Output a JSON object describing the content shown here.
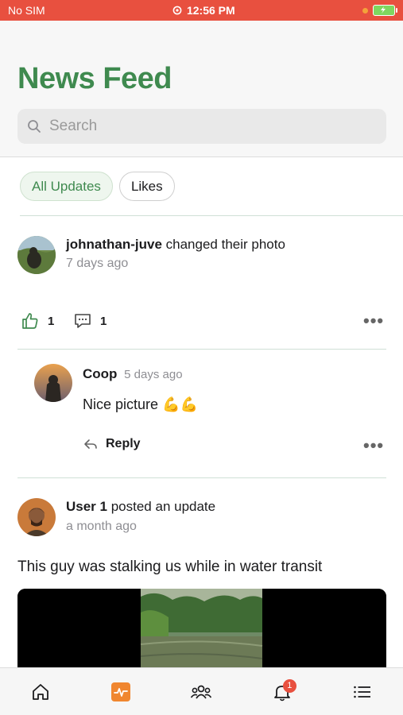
{
  "status_bar": {
    "carrier": "No SIM",
    "time": "12:56 PM"
  },
  "header": {
    "title": "News Feed",
    "search_placeholder": "Search"
  },
  "filters": [
    {
      "label": "All Updates",
      "active": true
    },
    {
      "label": "Likes",
      "active": false
    }
  ],
  "posts": [
    {
      "author": "johnathan-juve",
      "action": "changed their photo",
      "time": "7 days ago",
      "likes": "1",
      "comments_count": "1",
      "comments": [
        {
          "author": "Coop",
          "time": "5 days ago",
          "text": "Nice picture 💪💪",
          "reply_label": "Reply"
        }
      ]
    },
    {
      "author": "User 1",
      "action": "posted an update",
      "time": "a month ago",
      "text": "This guy was stalking us while in water transit"
    }
  ],
  "tabbar": {
    "items": [
      {
        "icon": "home-icon"
      },
      {
        "icon": "activity-icon",
        "active": true
      },
      {
        "icon": "groups-icon"
      },
      {
        "icon": "bell-icon",
        "badge": "1"
      },
      {
        "icon": "menu-icon"
      }
    ]
  },
  "colors": {
    "accent": "#3f8a4f",
    "status_bar": "#e8503f",
    "badge": "#e8503f",
    "activity_tab": "#f0862f"
  }
}
